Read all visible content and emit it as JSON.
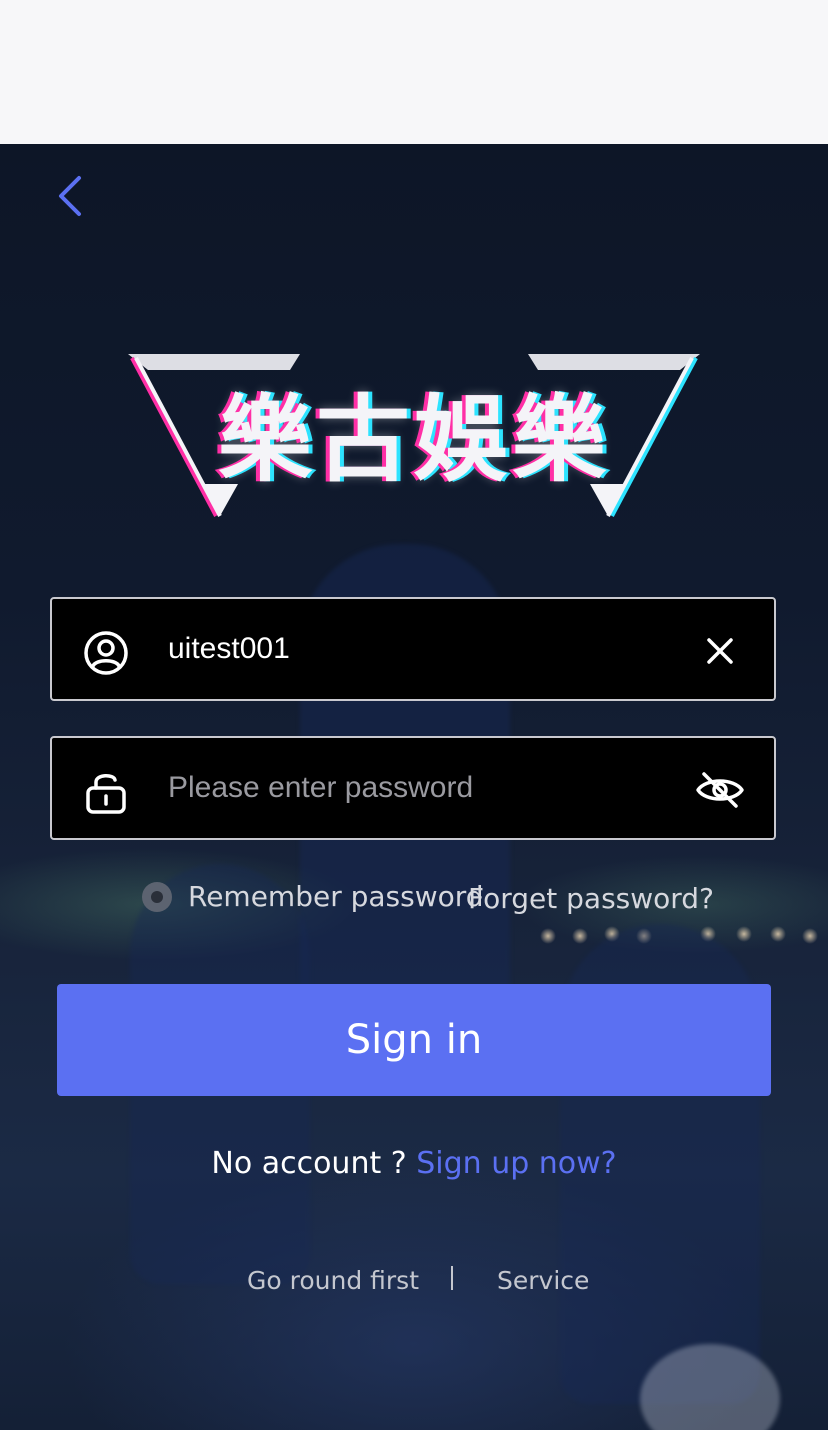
{
  "header": {
    "back_icon": "chevron-left-icon"
  },
  "logo": {
    "text": "樂古娛樂"
  },
  "username": {
    "value": "uitest001",
    "icon": "user-circle-icon",
    "clear_icon": "close-icon"
  },
  "password": {
    "value": "",
    "placeholder": "Please enter password",
    "icon": "lock-icon",
    "visibility_icon": "eye-off-icon"
  },
  "options": {
    "remember_label": "Remember password",
    "remember_checked": false,
    "forget_label": "Forget password?"
  },
  "signin": {
    "label": "Sign in"
  },
  "signup": {
    "prompt": "No account ? ",
    "link": "Sign up now?"
  },
  "footer": {
    "go_round": "Go round first",
    "service": "Service"
  },
  "colors": {
    "accent": "#5b70f2",
    "field_border": "#c9c9cf",
    "field_bg": "#000000",
    "back_icon": "#5b70f2"
  }
}
